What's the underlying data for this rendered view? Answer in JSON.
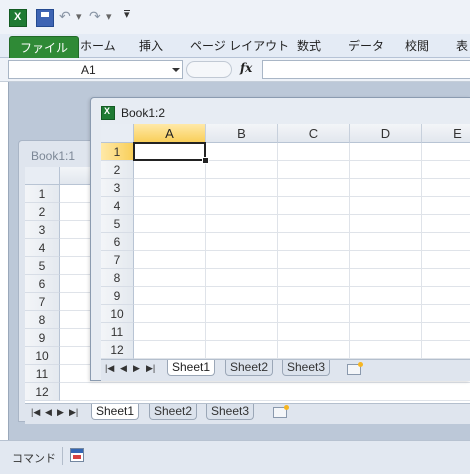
{
  "qat": {
    "customize_label": "▾"
  },
  "ribbon": {
    "tabs": [
      "ファイル",
      "ホーム",
      "挿入",
      "ページ レイアウト",
      "数式",
      "データ",
      "校閲",
      "表"
    ]
  },
  "formula_bar": {
    "name_box": "A1",
    "fx_label": "fx",
    "formula": ""
  },
  "window1": {
    "title": "Book1:1",
    "rows": [
      "1",
      "2",
      "3",
      "4",
      "5",
      "6",
      "7",
      "8",
      "9",
      "10",
      "11",
      "12"
    ],
    "sheets": [
      "Sheet1",
      "Sheet2",
      "Sheet3"
    ],
    "active_sheet": "Sheet1"
  },
  "window2": {
    "title": "Book1:2",
    "columns": [
      "A",
      "B",
      "C",
      "D",
      "E"
    ],
    "rows": [
      "1",
      "2",
      "3",
      "4",
      "5",
      "6",
      "7",
      "8",
      "9",
      "10",
      "11",
      "12"
    ],
    "sheets": [
      "Sheet1",
      "Sheet2",
      "Sheet3"
    ],
    "active_sheet": "Sheet1",
    "active_cell": "A1"
  },
  "status_bar": {
    "mode": "コマンド"
  },
  "colors": {
    "file_tab": "#2f8a36",
    "selected_header": "#f9cf5a",
    "workspace": "#bcc8d8"
  }
}
